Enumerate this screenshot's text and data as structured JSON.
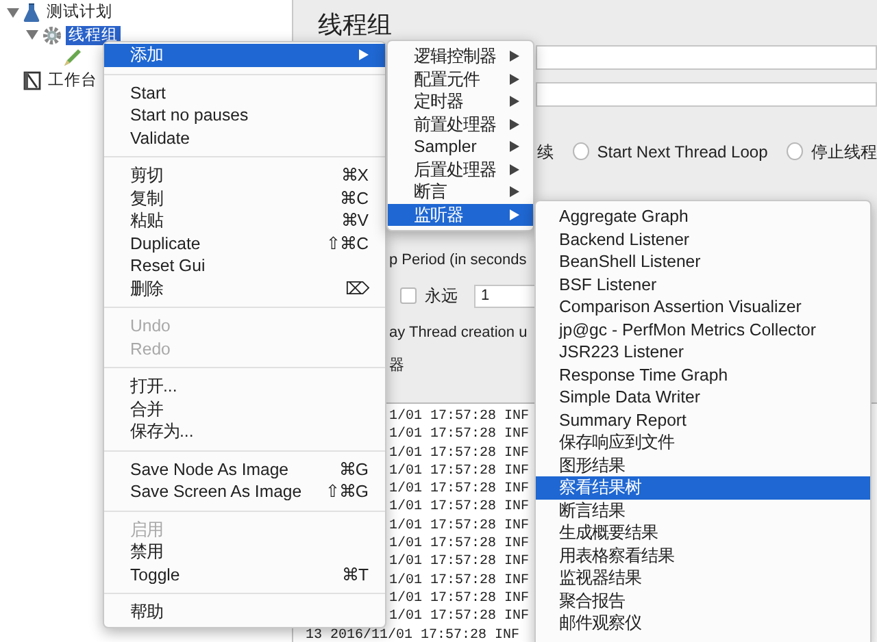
{
  "tree": [
    {
      "label": "测试计划",
      "kind": "plan",
      "expanded": true,
      "selected": false,
      "children": [
        {
          "label": "线程组",
          "kind": "thread-group",
          "expanded": true,
          "selected": true,
          "children": [
            {
              "kind": "sampler"
            }
          ]
        }
      ]
    },
    {
      "label": "工作台",
      "kind": "workbench",
      "selected": false
    }
  ],
  "panel": {
    "title": "线程组",
    "error_fragment": "续",
    "radios": [
      {
        "label": "Start Next Thread Loop",
        "selected": false
      },
      {
        "label": "停止线程",
        "selected": false
      }
    ],
    "ramp_up_fragment": "p Period (in seconds",
    "loop": {
      "label": "永远",
      "checked": false,
      "value": "1"
    },
    "delay_fragment": "ay Thread creation u",
    "section_fragment": "器",
    "log_lines": [
      "1/01 17:57:28 INF",
      "1/01 17:57:28 INF",
      "1/01 17:57:28 INF",
      "1/01 17:57:28 INF",
      "1/01 17:57:28 INF",
      "1/01 17:57:28 INF",
      "1/01 17:57:28 INF",
      "1/01 17:57:28 INF",
      "1/01 17:57:28 INF",
      "1/01 17:57:28 INF",
      "1/01 17:57:28 INF",
      "1/01 17:57:28 INF"
    ],
    "last_log": {
      "number": "13",
      "text": "2016/11/01 17:57:28 INF"
    }
  },
  "context_menu": {
    "groups": [
      [
        {
          "label": "添加",
          "submenu": true,
          "disabled": false,
          "selected": true
        }
      ],
      [
        {
          "label": "Start",
          "disabled": false,
          "selected": false
        },
        {
          "label": "Start no pauses",
          "disabled": false,
          "selected": false
        },
        {
          "label": "Validate",
          "disabled": false,
          "selected": false
        }
      ],
      [
        {
          "label": "剪切",
          "shortcut": "⌘X",
          "disabled": false,
          "selected": false
        },
        {
          "label": "复制",
          "shortcut": "⌘C",
          "disabled": false,
          "selected": false
        },
        {
          "label": "粘贴",
          "shortcut": "⌘V",
          "disabled": false,
          "selected": false
        },
        {
          "label": "Duplicate",
          "shortcut": "⇧⌘C",
          "disabled": false,
          "selected": false
        },
        {
          "label": "Reset Gui",
          "disabled": false,
          "selected": false
        },
        {
          "label": "删除",
          "shortcut": "⌦",
          "disabled": false,
          "selected": false
        }
      ],
      [
        {
          "label": "Undo",
          "disabled": true,
          "selected": false
        },
        {
          "label": "Redo",
          "disabled": true,
          "selected": false
        }
      ],
      [
        {
          "label": "打开...",
          "disabled": false,
          "selected": false
        },
        {
          "label": "合并",
          "disabled": false,
          "selected": false
        },
        {
          "label": "保存为...",
          "disabled": false,
          "selected": false
        }
      ],
      [
        {
          "label": "Save Node As Image",
          "shortcut": "⌘G",
          "disabled": false,
          "selected": false
        },
        {
          "label": "Save Screen As Image",
          "shortcut": "⇧⌘G",
          "disabled": false,
          "selected": false
        }
      ],
      [
        {
          "label": "启用",
          "disabled": true,
          "selected": false
        },
        {
          "label": "禁用",
          "disabled": false,
          "selected": false
        },
        {
          "label": "Toggle",
          "shortcut": "⌘T",
          "disabled": false,
          "selected": false
        }
      ],
      [
        {
          "label": "帮助",
          "disabled": false,
          "selected": false
        }
      ]
    ]
  },
  "add_submenu": [
    {
      "label": "逻辑控制器",
      "submenu": true,
      "selected": false
    },
    {
      "label": "配置元件",
      "submenu": true,
      "selected": false
    },
    {
      "label": "定时器",
      "submenu": true,
      "selected": false
    },
    {
      "label": "前置处理器",
      "submenu": true,
      "selected": false
    },
    {
      "label": "Sampler",
      "submenu": true,
      "selected": false
    },
    {
      "label": "后置处理器",
      "submenu": true,
      "selected": false
    },
    {
      "label": "断言",
      "submenu": true,
      "selected": false
    },
    {
      "label": "监听器",
      "submenu": true,
      "selected": true
    }
  ],
  "listener_submenu": [
    {
      "label": "Aggregate Graph",
      "selected": false
    },
    {
      "label": "Backend Listener",
      "selected": false
    },
    {
      "label": "BeanShell Listener",
      "selected": false
    },
    {
      "label": "BSF Listener",
      "selected": false
    },
    {
      "label": "Comparison Assertion Visualizer",
      "selected": false
    },
    {
      "label": "jp@gc - PerfMon Metrics Collector",
      "selected": false
    },
    {
      "label": "JSR223 Listener",
      "selected": false
    },
    {
      "label": "Response Time Graph",
      "selected": false
    },
    {
      "label": "Simple Data Writer",
      "selected": false
    },
    {
      "label": "Summary Report",
      "selected": false
    },
    {
      "label": "保存响应到文件",
      "selected": false
    },
    {
      "label": "图形结果",
      "selected": false
    },
    {
      "label": "察看结果树",
      "selected": true
    },
    {
      "label": "断言结果",
      "selected": false
    },
    {
      "label": "生成概要结果",
      "selected": false
    },
    {
      "label": "用表格察看结果",
      "selected": false
    },
    {
      "label": "监视器结果",
      "selected": false
    },
    {
      "label": "聚合报告",
      "selected": false
    },
    {
      "label": "邮件观察仪",
      "selected": false
    }
  ]
}
